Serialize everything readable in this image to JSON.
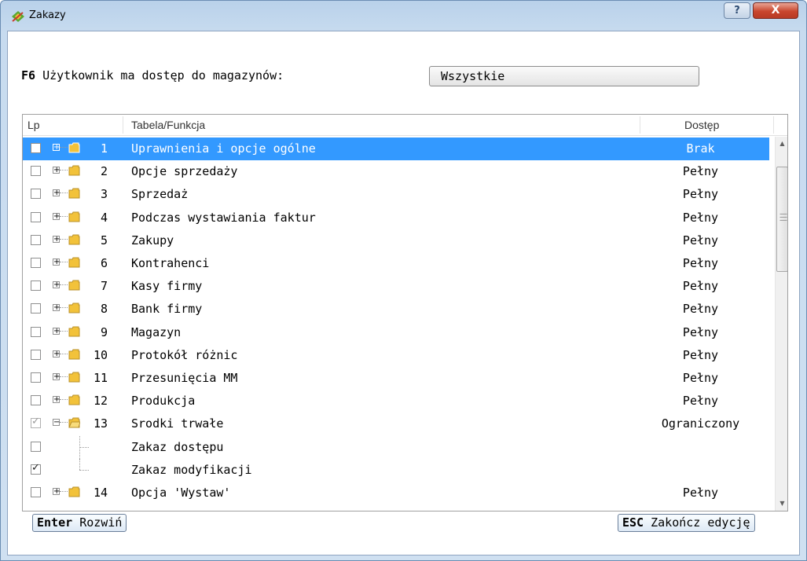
{
  "window": {
    "title": "Zakazy",
    "help_glyph": "?",
    "close_glyph": "X"
  },
  "warehouse": {
    "hotkey": "F6",
    "label": "Użytkownik ma dostęp do magazynów:",
    "value": "Wszystkie"
  },
  "grid": {
    "columns": {
      "lp": "Lp",
      "table": "Tabela/Funkcja",
      "access": "Dostęp"
    },
    "rows": [
      {
        "num": "1",
        "name": "Uprawnienia i opcje ogólne",
        "access": "Brak",
        "checked": false,
        "selected": true
      },
      {
        "num": "2",
        "name": "Opcje sprzedaży",
        "access": "Pełny",
        "checked": false
      },
      {
        "num": "3",
        "name": "Sprzedaż",
        "access": "Pełny",
        "checked": false
      },
      {
        "num": "4",
        "name": "Podczas wystawiania faktur",
        "access": "Pełny",
        "checked": false
      },
      {
        "num": "5",
        "name": "Zakupy",
        "access": "Pełny",
        "checked": false
      },
      {
        "num": "6",
        "name": "Kontrahenci",
        "access": "Pełny",
        "checked": false
      },
      {
        "num": "7",
        "name": "Kasy firmy",
        "access": "Pełny",
        "checked": false
      },
      {
        "num": "8",
        "name": "Bank firmy",
        "access": "Pełny",
        "checked": false
      },
      {
        "num": "9",
        "name": "Magazyn",
        "access": "Pełny",
        "checked": false
      },
      {
        "num": "10",
        "name": "Protokół różnic",
        "access": "Pełny",
        "checked": false
      },
      {
        "num": "11",
        "name": "Przesunięcia MM",
        "access": "Pełny",
        "checked": false
      },
      {
        "num": "12",
        "name": "Produkcja",
        "access": "Pełny",
        "checked": false
      },
      {
        "num": "13",
        "name": "Srodki trwałe",
        "access": "Ograniczony",
        "checked": true,
        "grey": true,
        "expanded": true
      },
      {
        "num": "",
        "name": "Zakaz dostępu",
        "access": "",
        "checked": false,
        "child": true
      },
      {
        "num": "",
        "name": "Zakaz modyfikacji",
        "access": "",
        "checked": true,
        "child": true,
        "last": true
      },
      {
        "num": "14",
        "name": "Opcja 'Wystaw'",
        "access": "Pełny",
        "checked": false
      }
    ]
  },
  "footer": {
    "expand_key": "Enter",
    "expand_label": "Rozwiń",
    "end_key": "ESC",
    "end_label": "Zakończ edycję"
  },
  "colors": {
    "selection": "#3399ff",
    "folder": "#f2c23a"
  }
}
